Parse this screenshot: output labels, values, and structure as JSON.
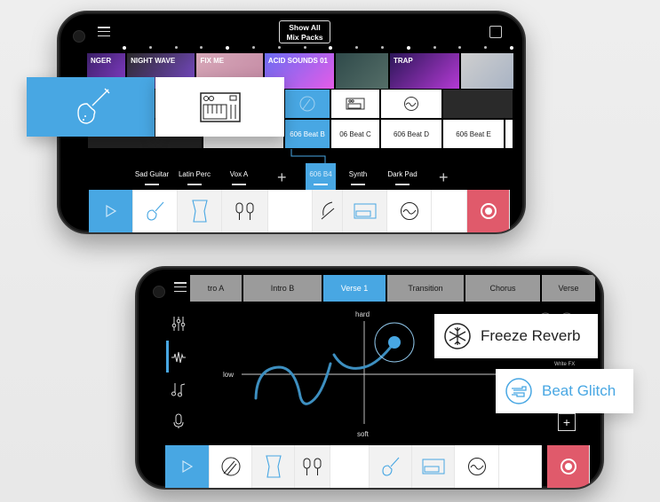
{
  "phone1": {
    "show_all_button": "Show All\nMix Packs",
    "show_all_line1": "Show All",
    "show_all_line2": "Mix Packs",
    "mix_packs": [
      {
        "name": "NGER",
        "colors": [
          "#3a1f66",
          "#8a3fd0"
        ]
      },
      {
        "name": "NIGHT WAVE",
        "colors": [
          "#2a2a2a",
          "#7c4bd0"
        ]
      },
      {
        "name": "FIX ME",
        "colors": [
          "#d7a7b8",
          "#c48aa4"
        ]
      },
      {
        "name": "ACID SOUNDS 01",
        "colors": [
          "#6a6cf2",
          "#e45ce8"
        ]
      },
      {
        "name": "",
        "colors": [
          "#2f4a4a",
          "#556e68"
        ]
      },
      {
        "name": "TRAP",
        "colors": [
          "#2b1658",
          "#b43ad4"
        ]
      },
      {
        "name": "",
        "colors": [
          "#cfcfcf",
          "#a8b3c4"
        ]
      }
    ],
    "beat_cells": [
      "606 Beat B",
      "06 Beat C",
      "606 Beat D",
      "606 Beat E"
    ],
    "track_labels": [
      "Sad Guitar",
      "Latin Perc",
      "Vox A",
      "606 B4",
      "Synth",
      "Dark Pad"
    ],
    "add_symbol": "+",
    "active_track": "606 B4"
  },
  "phone2": {
    "tabs": [
      "tro A",
      "Intro B",
      "Verse 1",
      "Transition",
      "Chorus",
      "Verse"
    ],
    "active_tab": "Verse 1",
    "pad": {
      "top_label": "hard",
      "bottom_label": "soft",
      "left_label": "low"
    },
    "write_fx": "Write FX",
    "add_symbol": "+"
  },
  "callouts": {
    "freeze_reverb": "Freeze Reverb",
    "beat_glitch": "Beat Glitch"
  },
  "colors": {
    "accent_blue": "#48a7e3",
    "record_red": "#e05a6b",
    "background": "#ececec"
  }
}
